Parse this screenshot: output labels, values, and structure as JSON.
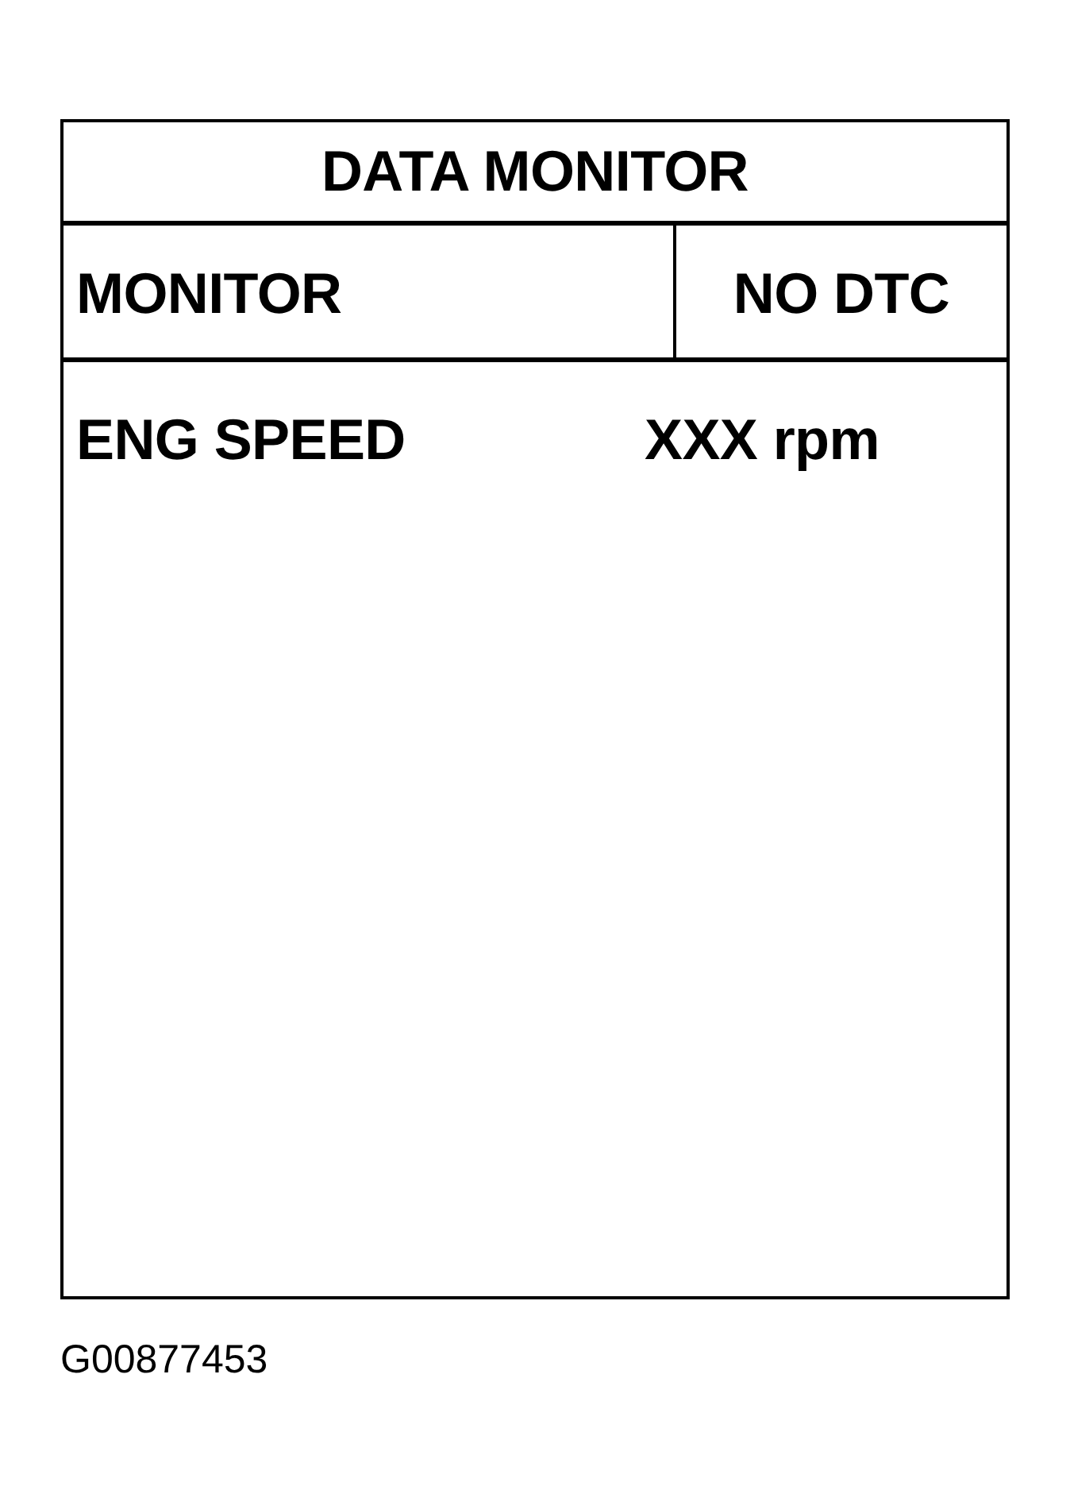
{
  "header": {
    "title": "DATA MONITOR"
  },
  "status_row": {
    "label": "MONITOR",
    "status": "NO DTC"
  },
  "readings": [
    {
      "name": "ENG SPEED",
      "value": "XXX rpm"
    }
  ],
  "figure_code": "G00877453"
}
